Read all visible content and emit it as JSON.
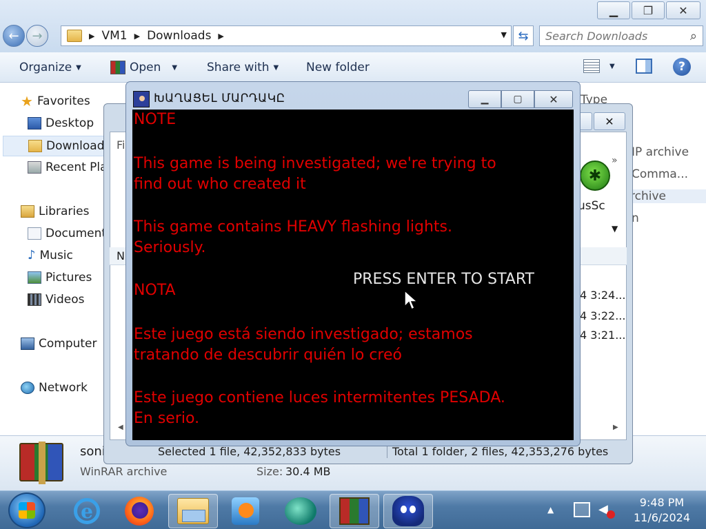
{
  "explorer": {
    "breadcrumb": [
      "VM1",
      "Downloads"
    ],
    "search_placeholder": "Search Downloads",
    "toolbar": {
      "organize": "Organize",
      "open": "Open",
      "share_with": "Share with",
      "new_folder": "New folder"
    },
    "nav": {
      "favorites": "Favorites",
      "desktop": "Desktop",
      "downloads": "Downloads",
      "recent_places": "Recent Places",
      "libraries": "Libraries",
      "documents": "Documents",
      "music": "Music",
      "pictures": "Pictures",
      "videos": "Videos",
      "computer": "Computer",
      "network": "Network"
    },
    "right_column": {
      "type_header": "Type",
      "rows": [
        "IP archive",
        "Comma...",
        "rchive",
        "n"
      ]
    },
    "details": {
      "name": "soni",
      "type": "WinRAR archive",
      "size_label": "Size:",
      "size_value": "30.4 MB"
    }
  },
  "winrar": {
    "column_letter": "N",
    "left_label": "Fi",
    "tool_label": "rusSc",
    "times": [
      "4 3:24...",
      "4 3:22...",
      "4 3:21..."
    ],
    "status_left": "Selected 1 file, 42,352,833 bytes",
    "status_right": "Total 1 folder, 2 files, 42,353,276 bytes"
  },
  "game": {
    "title": "ԽԱՂԱՑԵԼ ՄԱՐԴԱԿԸ",
    "lines": [
      "NOTE",
      "This game is being investigated; we're trying to",
      "find out who created it",
      "This game contains HEAVY flashing lights.",
      "Seriously.",
      "NOTA",
      "Este juego está siendo investigado; estamos",
      "tratando de descubrir quién lo creó",
      "Este juego contiene luces intermitentes PESADA.",
      "En serio."
    ],
    "press_start": "PRESS ENTER TO START",
    "text_color": "#e10000"
  },
  "taskbar": {
    "time": "9:48 PM",
    "date": "11/6/2024"
  }
}
